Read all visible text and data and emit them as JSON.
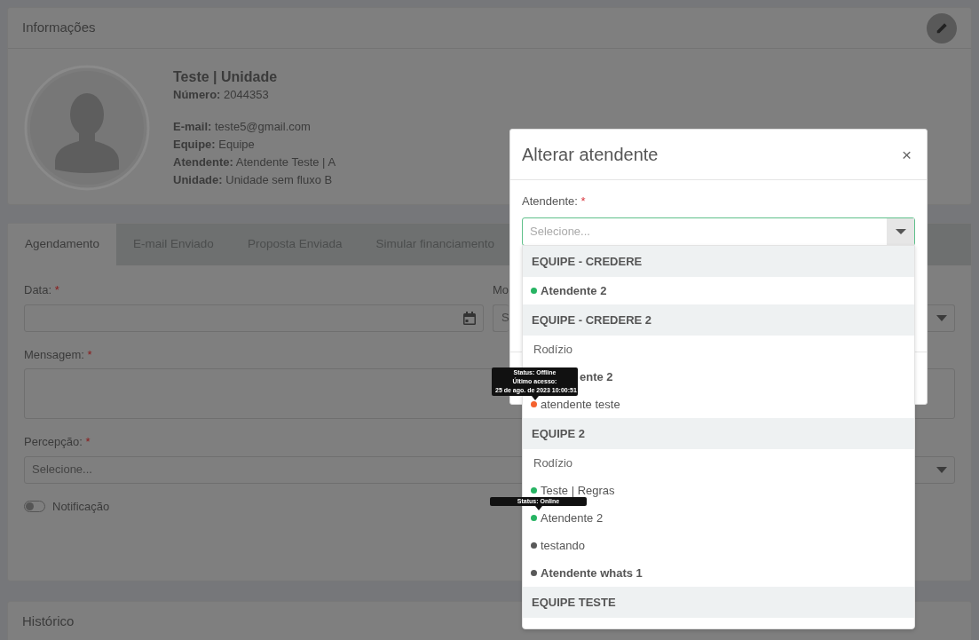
{
  "info_card": {
    "title": "Informações",
    "name": "Teste | Unidade",
    "number": {
      "label": "Número:",
      "value": "2044353"
    },
    "fields": [
      {
        "label": "E-mail:",
        "value": "teste5@gmail.com"
      },
      {
        "label": "Equipe:",
        "value": "Equipe"
      },
      {
        "label": "Atendente:",
        "value": "Atendente Teste | A"
      },
      {
        "label": "Unidade:",
        "value": "Unidade sem fluxo B"
      }
    ]
  },
  "tabs": [
    {
      "label": "Agendamento",
      "selected": true
    },
    {
      "label": "E-mail Enviado",
      "selected": false
    },
    {
      "label": "Proposta Enviada",
      "selected": false
    },
    {
      "label": "Simular financiamento",
      "selected": false
    }
  ],
  "form": {
    "date": {
      "label": "Data:",
      "required_mark": "*"
    },
    "column_2": {
      "label": "Mo",
      "placeholder": "S"
    },
    "message": {
      "label": "Mensagem:",
      "required_mark": "*"
    },
    "perception": {
      "label": "Percepção:",
      "required_mark": "*",
      "placeholder": "Selecione..."
    },
    "notification": {
      "label": "Notificação",
      "on": false
    }
  },
  "history_card": {
    "title": "Histórico"
  },
  "modal": {
    "title": "Alterar atendente",
    "close": "×",
    "field": {
      "label": "Atendente:",
      "required_mark": "*",
      "placeholder": "Selecione..."
    },
    "groups": [
      {
        "label": "EQUIPE - CREDERE",
        "items": [
          {
            "kind": "agent",
            "label": "Atendente 2",
            "bold": true,
            "covered": false,
            "color": "#27b463"
          }
        ]
      },
      {
        "label": "EQUIPE - CREDERE 2",
        "items": [
          {
            "kind": "rotation",
            "label": "Rodízio"
          },
          {
            "kind": "agent",
            "label": "ente 2",
            "bold": true,
            "covered": true
          },
          {
            "kind": "agent",
            "label": "atendente teste",
            "bold": false,
            "covered": false,
            "color": "#f4622f",
            "tooltip": [
              "Status: Offline",
              "Último acesso:",
              "25 de ago. de 2023 10:00:51"
            ]
          }
        ]
      },
      {
        "label": "EQUIPE 2",
        "items": [
          {
            "kind": "rotation",
            "label": "Rodízio"
          },
          {
            "kind": "agent",
            "label": "Teste | Regras",
            "bold": false,
            "covered": false,
            "color": "#27b463"
          },
          {
            "kind": "agent",
            "label": "Atendente 2",
            "bold": false,
            "covered": false,
            "color": "#27b463",
            "tooltip": [
              "Status: Online"
            ]
          },
          {
            "kind": "agent",
            "label": "testando",
            "bold": false,
            "covered": false,
            "color": "#595959"
          },
          {
            "kind": "agent",
            "label": "Atendente whats 1",
            "bold": true,
            "covered": false,
            "color": "#595959"
          }
        ]
      },
      {
        "label": "EQUIPE TESTE"
      }
    ]
  }
}
